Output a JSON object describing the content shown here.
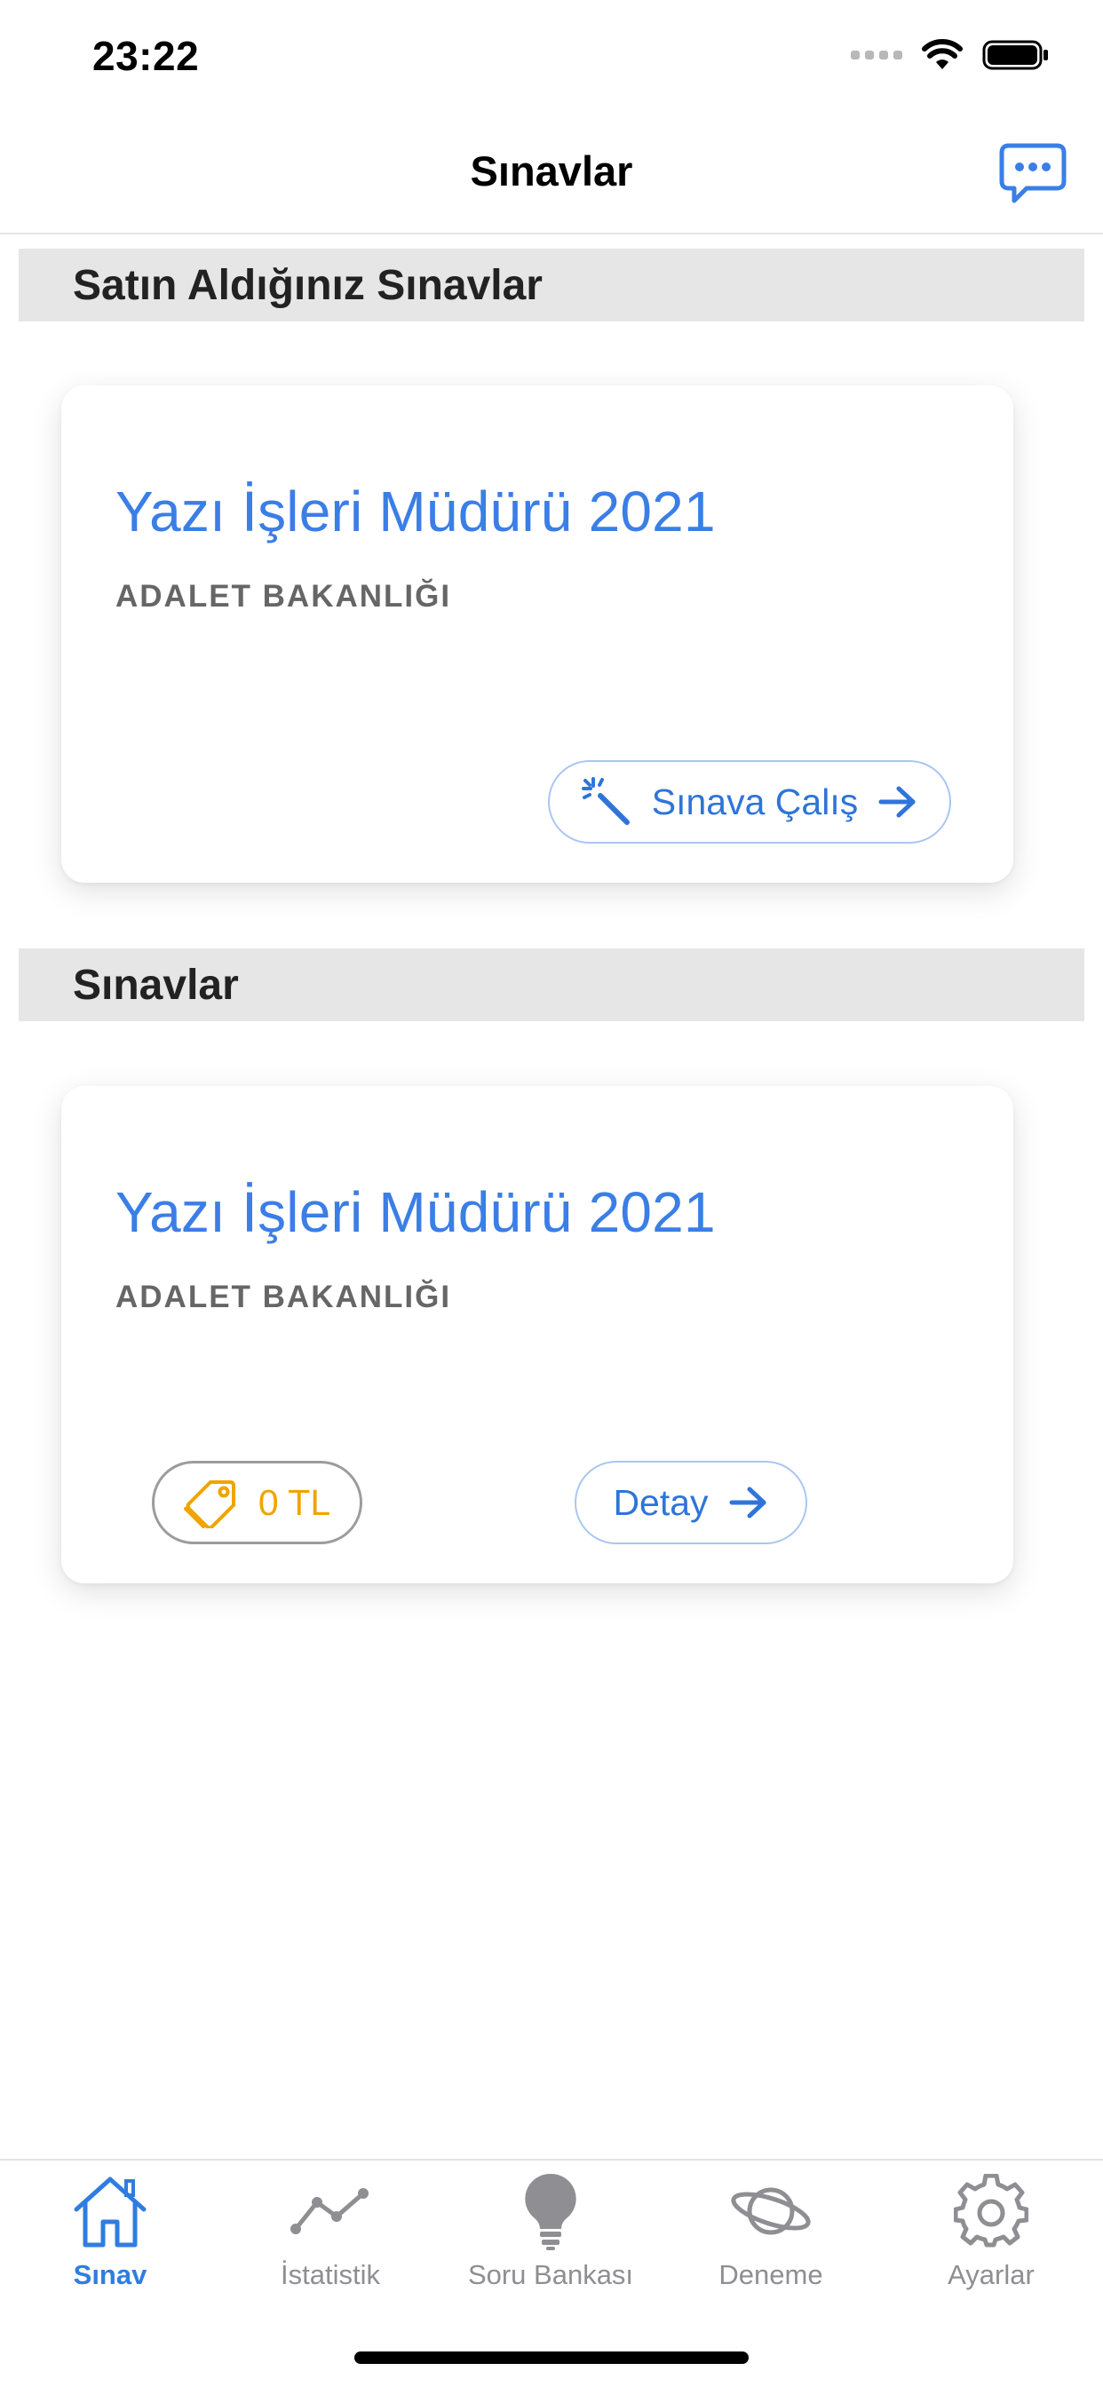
{
  "status_bar": {
    "time": "23:22"
  },
  "nav": {
    "title": "Sınavlar"
  },
  "sections": [
    {
      "header": "Satın Aldığınız Sınavlar",
      "card": {
        "title": "Yazı İşleri Müdürü 2021",
        "subtitle": "ADALET BAKANLIĞI",
        "study_button_label": "Sınava Çalış"
      }
    },
    {
      "header": "Sınavlar",
      "card": {
        "title": "Yazı İşleri Müdürü 2021",
        "subtitle": "ADALET BAKANLIĞI",
        "price_label": "0 TL",
        "detail_button_label": "Detay"
      }
    }
  ],
  "tab_bar": {
    "tabs": [
      {
        "label": "Sınav",
        "icon": "home-icon",
        "active": true
      },
      {
        "label": "İstatistik",
        "icon": "stats-line-icon",
        "active": false
      },
      {
        "label": "Soru Bankası",
        "icon": "lightbulb-icon",
        "active": false
      },
      {
        "label": "Deneme",
        "icon": "planet-icon",
        "active": false
      },
      {
        "label": "Ayarlar",
        "icon": "gear-icon",
        "active": false
      }
    ]
  },
  "colors": {
    "accent": "#3b7ee6",
    "price": "#f0a400",
    "section_bg": "#e6e6e6",
    "inactive_tab": "#8e8e93"
  }
}
